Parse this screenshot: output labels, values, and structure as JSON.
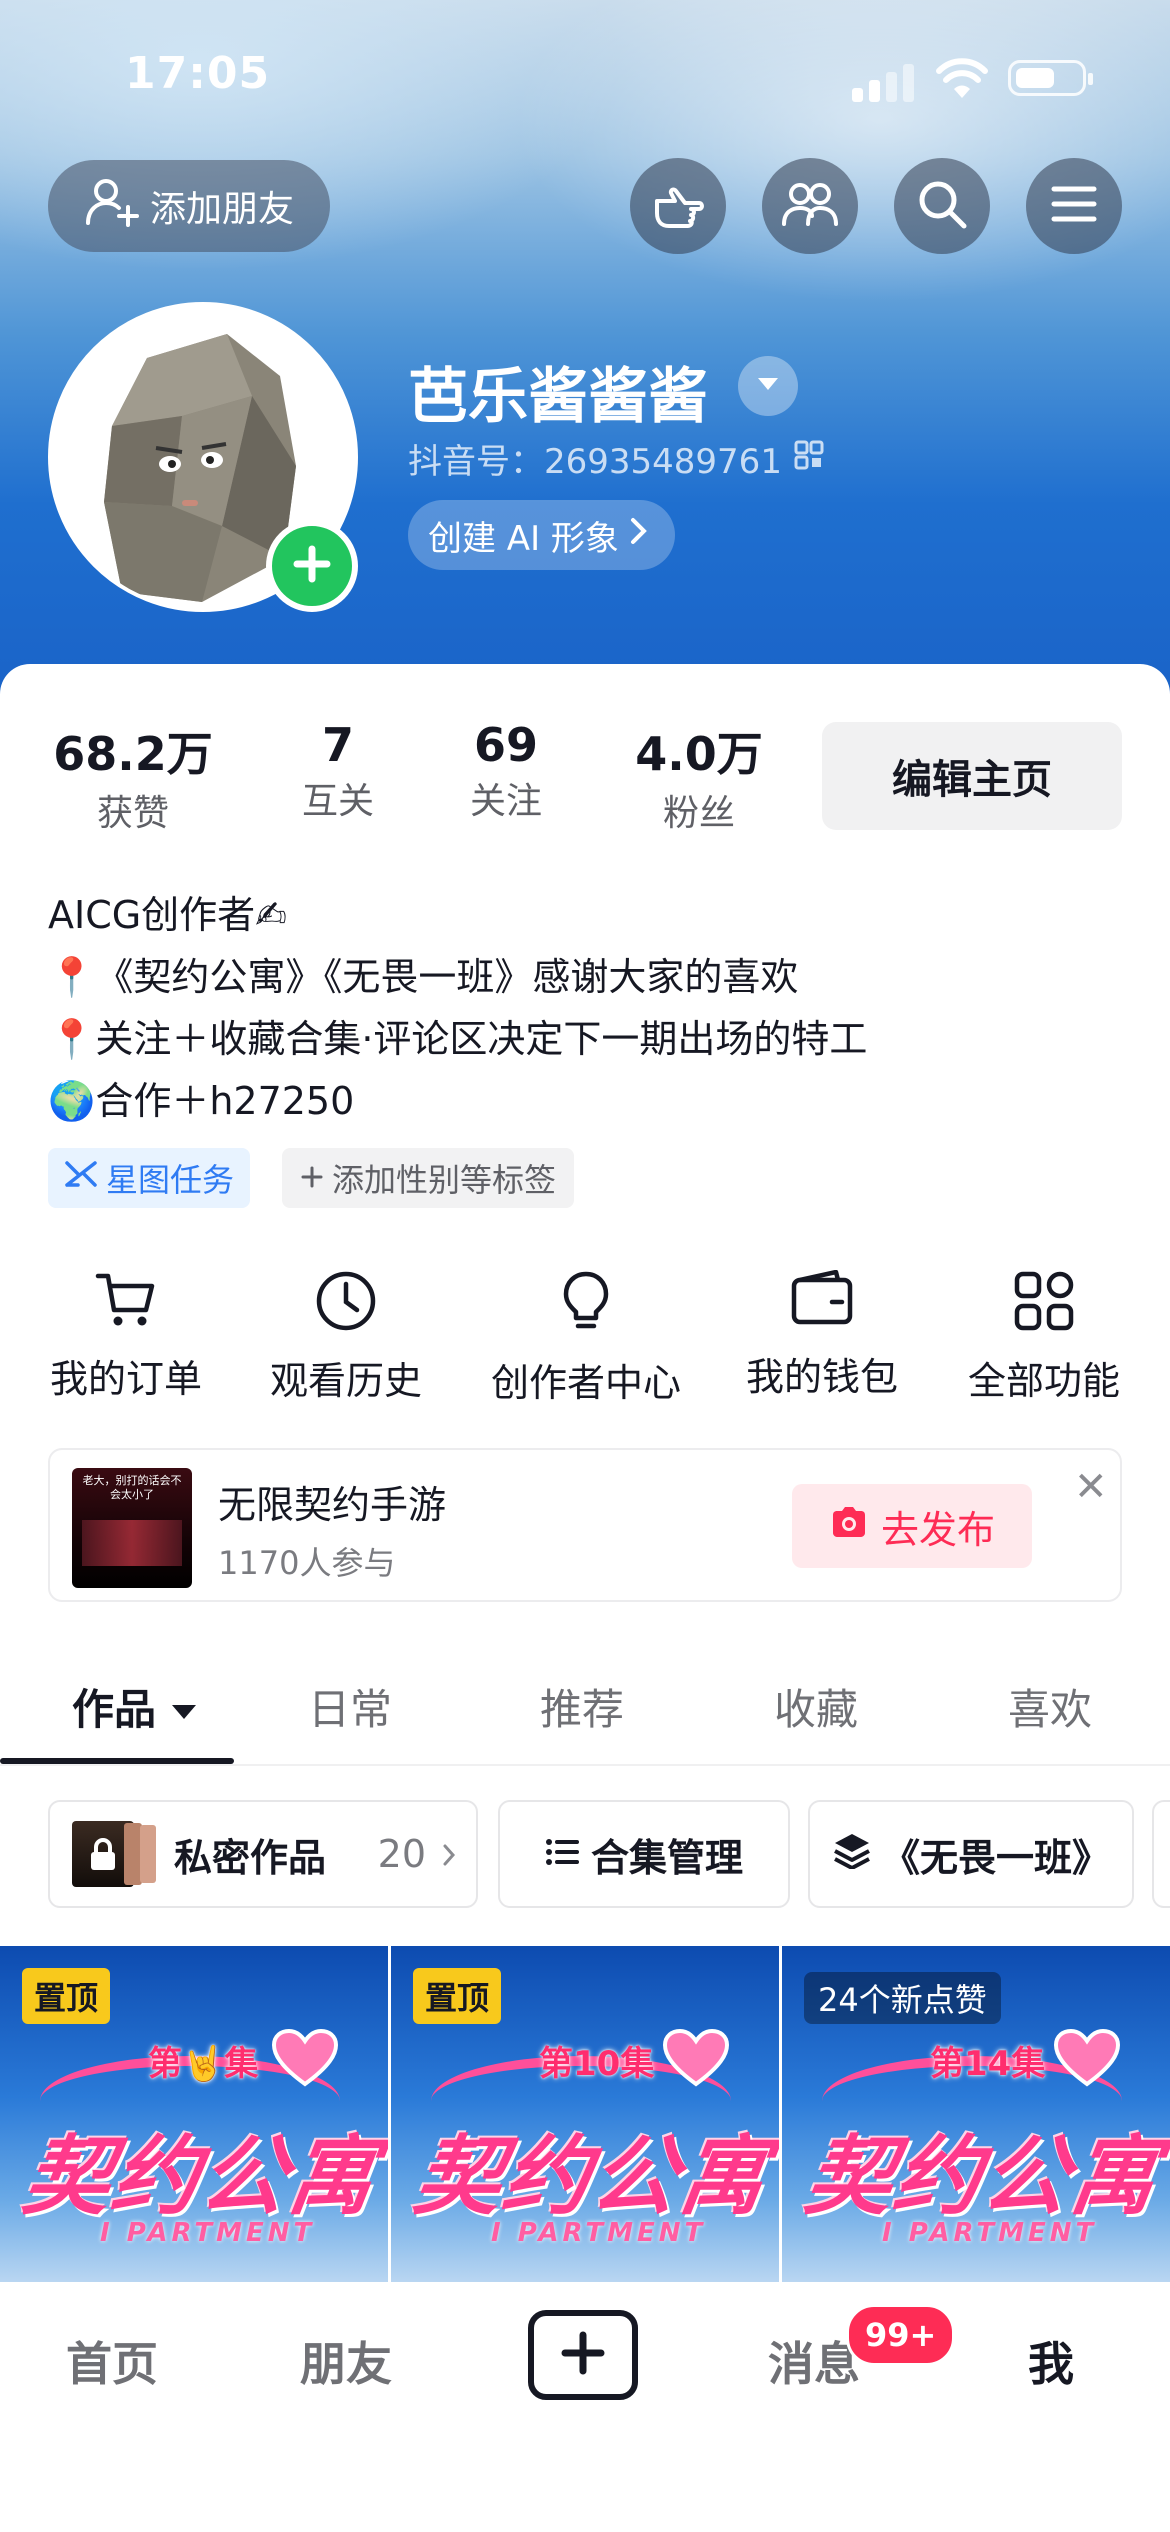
{
  "status_bar": {
    "time": "17:05"
  },
  "header": {
    "add_friend_label": "添加朋友",
    "buttons": [
      "pointing-hand-icon",
      "friends-icon",
      "search-icon",
      "menu-icon"
    ]
  },
  "profile": {
    "username": "芭乐酱酱酱",
    "douyin_id": "抖音号：26935489761",
    "ai_label": "创建 AI 形象"
  },
  "stats": [
    {
      "value": "68.2万",
      "label": "获赞"
    },
    {
      "value": "7",
      "label": "互关"
    },
    {
      "value": "69",
      "label": "关注"
    },
    {
      "value": "4.0万",
      "label": "粉丝"
    }
  ],
  "edit_label": "编辑主页",
  "bio": [
    "AICG创作者✍",
    "📍《契约公寓》《无畏一班》感谢大家的喜欢",
    "📍关注＋收藏合集·评论区决定下一期出场的特工",
    "🌍合作＋h27250"
  ],
  "tags": {
    "xingtu": "星图任务",
    "add_tag": "添加性别等标签"
  },
  "functions": [
    {
      "label": "我的订单",
      "icon": "cart-icon"
    },
    {
      "label": "观看历史",
      "icon": "clock-icon"
    },
    {
      "label": "创作者中心",
      "icon": "bulb-icon"
    },
    {
      "label": "我的钱包",
      "icon": "wallet-icon"
    },
    {
      "label": "全部功能",
      "icon": "grid-icon"
    }
  ],
  "promo": {
    "title": "无限契约手游",
    "subtitle": "1170人参与",
    "button": "去发布",
    "thumb_text": "老大，别打的话会不会太小了"
  },
  "tabs": [
    {
      "label": "作品",
      "active": true
    },
    {
      "label": "日常"
    },
    {
      "label": "推荐"
    },
    {
      "label": "收藏"
    },
    {
      "label": "喜欢"
    }
  ],
  "chips": {
    "private_label": "私密作品",
    "private_count": "20",
    "collection_label": "合集管理",
    "series_label": "《无畏一班》"
  },
  "videos": [
    {
      "badge": "置顶",
      "episode": "第🤘集",
      "title": "契约公寓",
      "sub": "I PARTMENT"
    },
    {
      "badge": "置顶",
      "episode": "第10集",
      "title": "契约公寓",
      "sub": "I PARTMENT"
    },
    {
      "badge": "24个新点赞",
      "episode": "第14集",
      "title": "契约公寓",
      "sub": "I PARTMENT"
    }
  ],
  "bottom_nav": {
    "home": "首页",
    "friends": "朋友",
    "messages": "消息",
    "messages_badge": "99+",
    "me": "我"
  },
  "colors": {
    "accent_red": "#fe2c55",
    "link_blue": "#2f7bf3",
    "pin_yellow": "#f8c91c",
    "add_green": "#22c55e"
  }
}
